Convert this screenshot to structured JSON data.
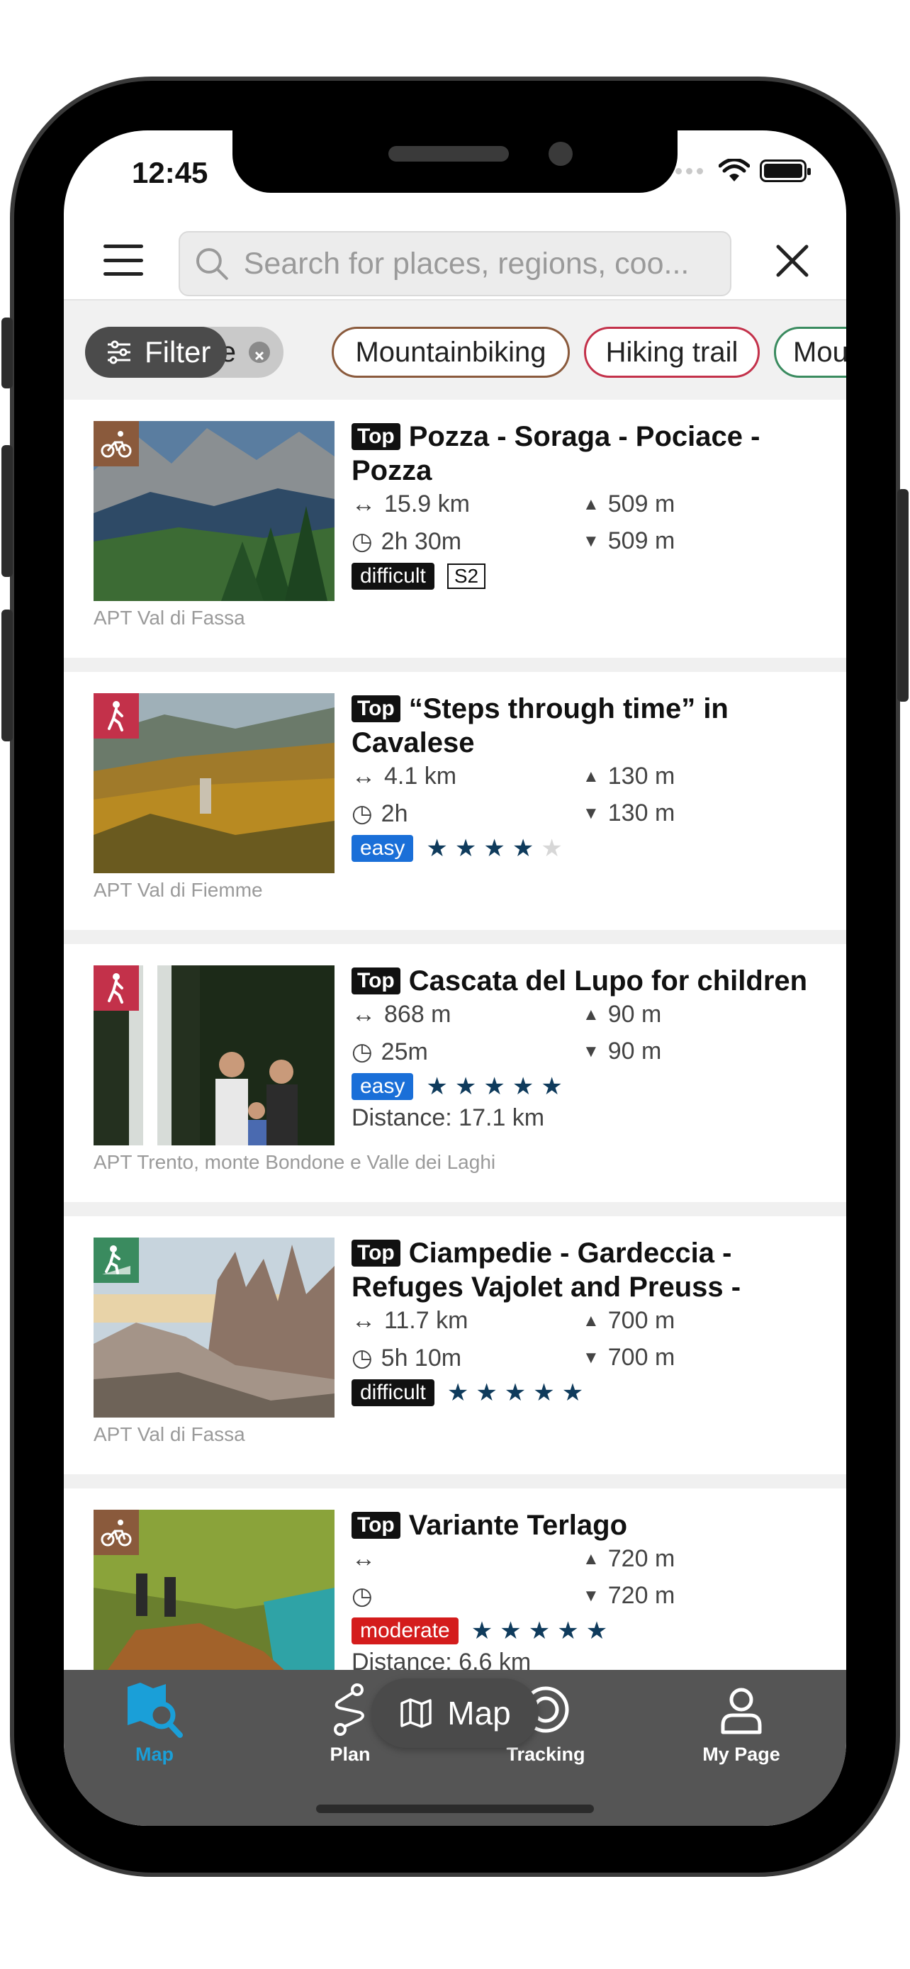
{
  "status": {
    "time": "12:45"
  },
  "search": {
    "placeholder": "Search for places, regions, coo..."
  },
  "filters": {
    "filter_label": "Filter",
    "chips": [
      "Route",
      "Mountainbiking",
      "Hiking trail",
      "Mou"
    ]
  },
  "items": [
    {
      "top": "Top",
      "title": "Pozza - Soraga - Pociace - Pozza",
      "distance": "15.9 km",
      "duration": "2h 30m",
      "ascent": "509 m",
      "descent": "509 m",
      "difficulty": "difficult",
      "difficulty_color": "#111111",
      "scale": "S2",
      "stars": 0,
      "source": "APT Val di Fassa",
      "category_icon": "mountainbike-icon",
      "category_color": "#8a5a3c"
    },
    {
      "top": "Top",
      "title": "“Steps through time” in Cavalese",
      "distance": "4.1 km",
      "duration": "2h",
      "ascent": "130 m",
      "descent": "130 m",
      "difficulty": "easy",
      "difficulty_color": "#1a6fd8",
      "stars": 4,
      "source": "APT Val di Fiemme",
      "category_icon": "hiking-icon",
      "category_color": "#c3314a"
    },
    {
      "top": "Top",
      "title": "Cascata del Lupo for children",
      "distance": "868 m",
      "duration": "25m",
      "ascent": "90 m",
      "descent": "90 m",
      "difficulty": "easy",
      "difficulty_color": "#1a6fd8",
      "stars": 5,
      "extra": "Distance: 17.1 km",
      "source": "APT Trento, monte Bondone e Valle dei Laghi",
      "category_icon": "hiking-icon",
      "category_color": "#c3314a"
    },
    {
      "top": "Top",
      "title": "Ciampedie - Gardeccia - Refuges Vajolet and Preuss -",
      "distance": "11.7 km",
      "duration": "5h 10m",
      "ascent": "700 m",
      "descent": "700 m",
      "difficulty": "difficult",
      "difficulty_color": "#111111",
      "stars": 5,
      "source": "APT Val di Fassa",
      "category_icon": "mountain-hike-icon",
      "category_color": "#3a8b5f"
    },
    {
      "top": "Top",
      "title": "Variante Terlago",
      "distance": "",
      "duration": "",
      "ascent": "720 m",
      "descent": "720 m",
      "difficulty": "moderate",
      "difficulty_color": "#d41c1c",
      "stars": 5,
      "extra": "Distance: 6.6 km",
      "category_icon": "mountainbike-icon",
      "category_color": "#8a5a3c"
    }
  ],
  "map_button": {
    "label": "Map"
  },
  "tabs": [
    {
      "label": "Map",
      "icon": "map-search-icon",
      "active": true
    },
    {
      "label": "Plan",
      "icon": "route-plan-icon",
      "active": false
    },
    {
      "label": "Tracking",
      "icon": "tracking-icon",
      "active": false
    },
    {
      "label": "My Page",
      "icon": "user-icon",
      "active": false
    }
  ]
}
